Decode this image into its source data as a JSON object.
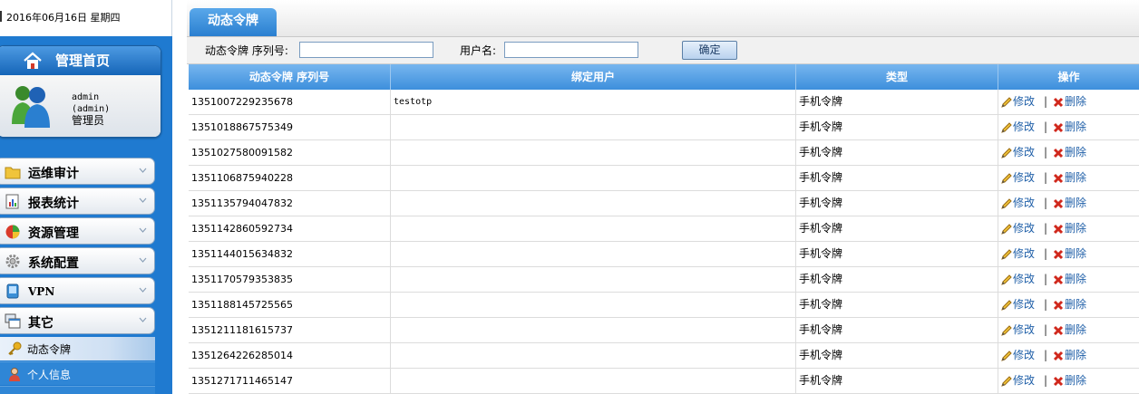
{
  "date_text": "2016年06月16日 星期四",
  "home": {
    "title": "管理首页",
    "user_line1": "admin",
    "user_line2": "(admin)",
    "role": "管理员"
  },
  "nav": [
    {
      "label": "运维审计",
      "icon": "folder-icon"
    },
    {
      "label": "报表统计",
      "icon": "report-icon"
    },
    {
      "label": "资源管理",
      "icon": "resource-icon"
    },
    {
      "label": "系统配置",
      "icon": "gear-icon"
    },
    {
      "label": "VPN",
      "icon": "vpn-icon"
    },
    {
      "label": "其它",
      "icon": "window-icon"
    }
  ],
  "subnav": [
    {
      "label": "动态令牌",
      "icon": "key-icon",
      "active": true
    },
    {
      "label": "个人信息",
      "icon": "user-icon",
      "active": false
    }
  ],
  "tab": {
    "label": "动态令牌"
  },
  "search": {
    "serial_label": "动态令牌 序列号:",
    "serial_value": "",
    "user_label": "用户名:",
    "user_value": "",
    "submit_label": "确定"
  },
  "table": {
    "headers": [
      "动态令牌 序列号",
      "绑定用户",
      "类型",
      "操作"
    ],
    "edit_label": "修改",
    "sep": "|",
    "delete_label": "删除",
    "rows": [
      {
        "serial": "1351007229235678",
        "user": "testotp",
        "type": "手机令牌"
      },
      {
        "serial": "1351018867575349",
        "user": "",
        "type": "手机令牌"
      },
      {
        "serial": "1351027580091582",
        "user": "",
        "type": "手机令牌"
      },
      {
        "serial": "1351106875940228",
        "user": "",
        "type": "手机令牌"
      },
      {
        "serial": "1351135794047832",
        "user": "",
        "type": "手机令牌"
      },
      {
        "serial": "1351142860592734",
        "user": "",
        "type": "手机令牌"
      },
      {
        "serial": "1351144015634832",
        "user": "",
        "type": "手机令牌"
      },
      {
        "serial": "1351170579353835",
        "user": "",
        "type": "手机令牌"
      },
      {
        "serial": "1351188145725565",
        "user": "",
        "type": "手机令牌"
      },
      {
        "serial": "1351211181615737",
        "user": "",
        "type": "手机令牌"
      },
      {
        "serial": "1351264226285014",
        "user": "",
        "type": "手机令牌"
      },
      {
        "serial": "1351271711465147",
        "user": "",
        "type": "手机令牌"
      }
    ]
  },
  "colors": {
    "accent": "#2a7fd0",
    "header_top": "#77b6ef",
    "link": "#1f5fa8",
    "delete": "#d0281c"
  }
}
